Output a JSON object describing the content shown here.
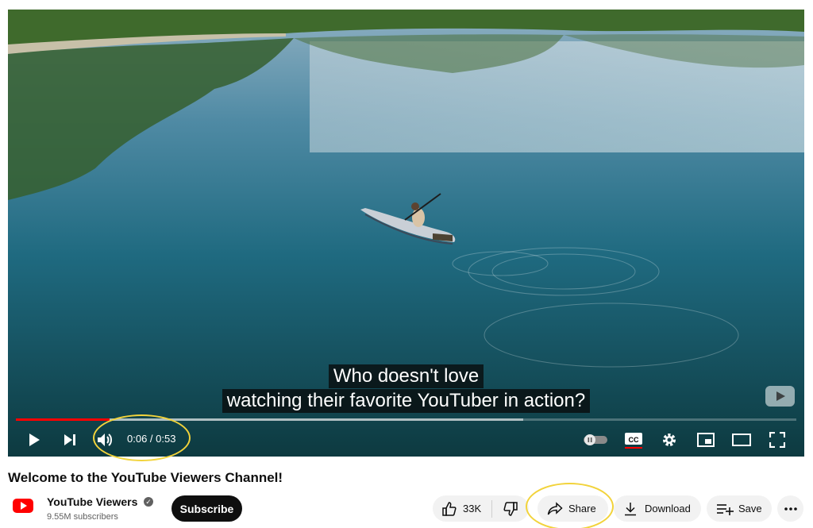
{
  "player": {
    "captions": [
      "Who doesn't love",
      "watching their favorite YouTuber in action?"
    ],
    "time_current": "0:06",
    "time_separator": " / ",
    "time_total": "0:53",
    "progress_played_fraction": 0.12,
    "progress_loaded_fraction": 0.65
  },
  "video": {
    "title": "Welcome to the YouTube Viewers Channel!"
  },
  "channel": {
    "name": "YouTube Viewers",
    "subscribers": "9.55M subscribers",
    "subscribe_label": "Subscribe"
  },
  "actions": {
    "likes": "33K",
    "share_label": "Share",
    "download_label": "Download",
    "save_label": "Save"
  },
  "colors": {
    "accent": "#ff0000",
    "annotation": "#f2d33b"
  },
  "icons": [
    "play-icon",
    "next-icon",
    "volume-icon",
    "autoplay-toggle-icon",
    "captions-icon",
    "settings-icon",
    "miniplayer-icon",
    "theater-icon",
    "fullscreen-icon",
    "like-icon",
    "dislike-icon",
    "share-icon",
    "download-icon",
    "save-icon",
    "more-icon",
    "verified-icon"
  ]
}
